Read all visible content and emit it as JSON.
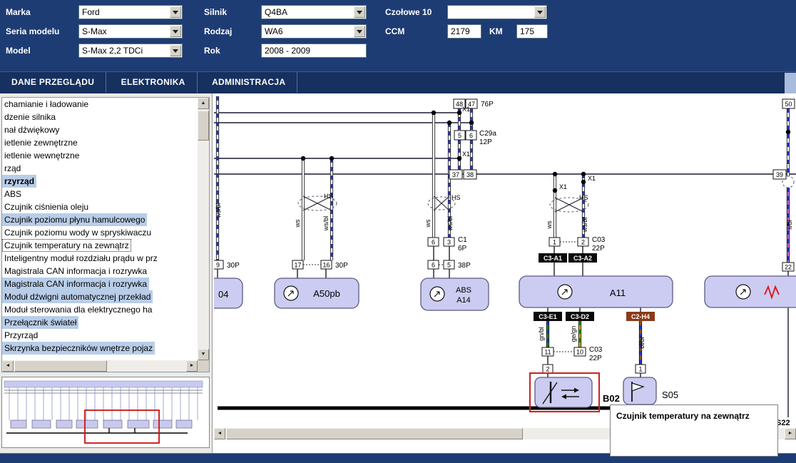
{
  "header": {
    "fields": {
      "marka": {
        "label": "Marka",
        "value": "Ford"
      },
      "seria_modelu": {
        "label": "Seria modelu",
        "value": "S-Max"
      },
      "model": {
        "label": "Model",
        "value": "S-Max 2,2 TDCi"
      },
      "silnik": {
        "label": "Silnik",
        "value": "Q4BA"
      },
      "rodzaj": {
        "label": "Rodzaj",
        "value": "WA6"
      },
      "rok": {
        "label": "Rok",
        "value": "2008 - 2009"
      },
      "czolowe": {
        "label": "Czołowe 10",
        "value": ""
      },
      "ccm": {
        "label": "CCM",
        "value": "2179"
      },
      "km": {
        "label": "KM",
        "value": "175"
      }
    }
  },
  "menu": {
    "items": [
      {
        "label": "DANE PRZEGLĄDU"
      },
      {
        "label": "ELEKTRONIKA"
      },
      {
        "label": "ADMINISTRACJA"
      }
    ]
  },
  "sidebar": {
    "items": [
      {
        "label": "chamianie i ładowanie",
        "state": "normal"
      },
      {
        "label": "dzenie silnika",
        "state": "normal"
      },
      {
        "label": "nał dźwiękowy",
        "state": "normal"
      },
      {
        "label": "ietlenie zewnętrzne",
        "state": "normal"
      },
      {
        "label": "ietlenie wewnętrzne",
        "state": "normal"
      },
      {
        "label": "rząd",
        "state": "normal"
      },
      {
        "label": "rzyrząd",
        "state": "category-highlighted"
      },
      {
        "label": "ABS",
        "state": "normal"
      },
      {
        "label": "Czujnik ciśnienia oleju",
        "state": "normal"
      },
      {
        "label": "Czujnik poziomu płynu hamulcowego",
        "state": "highlighted"
      },
      {
        "label": "Czujnik poziomu wody w spryskiwaczu",
        "state": "normal"
      },
      {
        "label": "Czujnik temperatury na zewnątrz",
        "state": "selected"
      },
      {
        "label": "Inteligentny moduł rozdziału prądu w prz",
        "state": "normal"
      },
      {
        "label": "Magistrala CAN informacja i rozrywka",
        "state": "normal"
      },
      {
        "label": "Magistrala CAN informacja i rozrywka",
        "state": "highlighted"
      },
      {
        "label": "Moduł dźwigni automatycznej przekład",
        "state": "highlighted"
      },
      {
        "label": "Moduł sterowania dla elektrycznego ha",
        "state": "normal"
      },
      {
        "label": "Przełącznik świateł",
        "state": "highlighted"
      },
      {
        "label": "Przyrząd",
        "state": "normal"
      },
      {
        "label": "Skrzynka bezpieczników wnętrze pojaz",
        "state": "highlighted"
      }
    ]
  },
  "diagram": {
    "tooltip": "Czujnik temperatury na zewnątrz",
    "components": {
      "a04": "04",
      "a50pb": "A50pb",
      "abs_name": "ABS",
      "abs_code": "A14",
      "a11": "A11",
      "b02": "B02",
      "s05": "S05",
      "s22": "S22"
    },
    "pins": {
      "n1": "1",
      "n2": "2",
      "n3": "3",
      "n5": "5",
      "n6": "6",
      "n9": "9",
      "n10": "10",
      "n11": "11",
      "n16": "16",
      "n17": "17",
      "n22": "22",
      "n37": "37",
      "n38": "38",
      "n39": "39",
      "n47": "47",
      "n48": "48",
      "n50": "50"
    },
    "connectors": {
      "c29a": "C29a",
      "c1": "C1",
      "c03": "C03",
      "p76": "76P",
      "p12": "12P",
      "p30": "30P",
      "p6": "6P",
      "p38": "38P",
      "p22": "22P",
      "c3a1": "C3-A1",
      "c3a2": "C3-A2",
      "c3e1": "C3-E1",
      "c3d2": "C3-D2",
      "c2h4": "C2-H4"
    },
    "wire_labels": {
      "ws": "ws",
      "ws_bl": "ws/bl",
      "gn_bl": "gn/bl",
      "ge_gn": "ge/gn",
      "bl_br": "bl/br",
      "li_bl": "li/bl"
    },
    "splices": {
      "x1": "X1",
      "hs": "HS"
    }
  },
  "colors": {
    "header_navy": "#1e3c74",
    "menu_navy": "#16305f",
    "highlight_blue": "#b8cde8",
    "component_fill": "#ccccf2",
    "red_highlight": "#cc2222",
    "tag_brown": "#8b3a1a"
  }
}
